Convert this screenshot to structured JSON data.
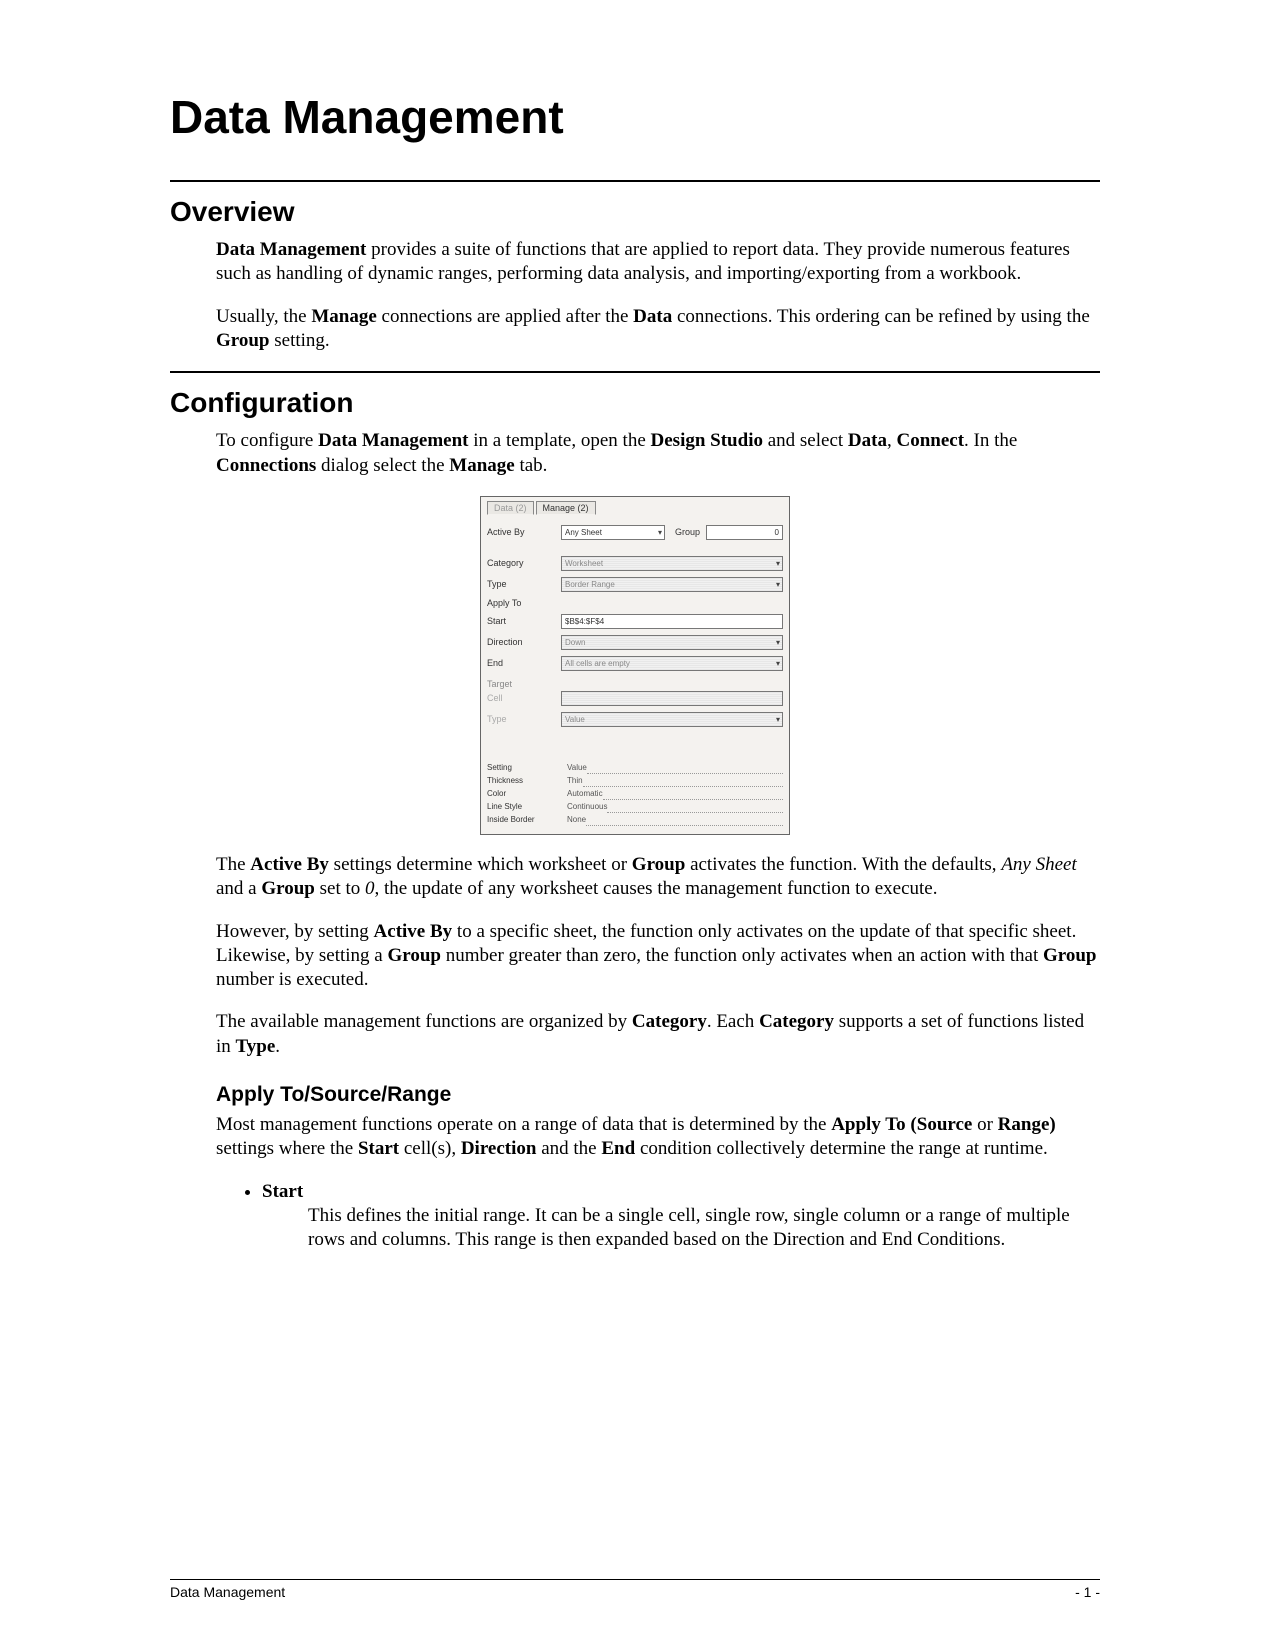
{
  "title": "Data Management",
  "sections": {
    "overview": {
      "heading": "Overview",
      "p1_pre": "Data Management",
      "p1_post": " provides a suite of functions that are applied to report data.  They provide numerous features such as handling of dynamic ranges, performing data analysis, and importing/exporting from a workbook.",
      "p2_a": "Usually, the ",
      "p2_b": "Manage",
      "p2_c": " connections are applied after the ",
      "p2_d": "Data",
      "p2_e": " connections.  This ordering can be refined by using the ",
      "p2_f": "Group",
      "p2_g": " setting."
    },
    "config": {
      "heading": "Configuration",
      "p1_a": "To configure ",
      "p1_b": "Data Management",
      "p1_c": " in a template, open the ",
      "p1_d": "Design Studio",
      "p1_e": " and select ",
      "p1_f": "Data",
      "p1_g": ", ",
      "p1_h": "Connect",
      "p1_i": ".  In the ",
      "p1_j": "Connections",
      "p1_k": " dialog select the ",
      "p1_l": "Manage",
      "p1_m": " tab.",
      "p2_a": "The ",
      "p2_b": "Active By",
      "p2_c": " settings determine which worksheet or ",
      "p2_d": "Group",
      "p2_e": " activates the function.  With the defaults, ",
      "p2_f": "Any Sheet",
      "p2_g": " and a ",
      "p2_h": "Group",
      "p2_i": " set to ",
      "p2_j": "0",
      "p2_k": ", the update of any worksheet causes the management function to execute.",
      "p3_a": "However, by setting ",
      "p3_b": "Active By",
      "p3_c": " to a specific sheet, the function only activates on the update of that specific sheet.  Likewise, by setting a ",
      "p3_d": "Group",
      "p3_e": " number greater than zero, the function only activates when an action with that ",
      "p3_f": "Group",
      "p3_g": " number is executed.",
      "p4_a": "The available management functions are organized by ",
      "p4_b": "Category",
      "p4_c": ".  Each ",
      "p4_d": "Category",
      "p4_e": " supports a set of functions listed in ",
      "p4_f": "Type",
      "p4_g": "."
    },
    "apply": {
      "heading": "Apply To/Source/Range",
      "p1_a": "Most management functions operate on a range of data that is determined by the ",
      "p1_b": "Apply To (Source",
      "p1_c": " or ",
      "p1_d": "Range)",
      "p1_e": " settings where the ",
      "p1_f": "Start",
      "p1_g": " cell(s), ",
      "p1_h": "Direction",
      "p1_i": " and the ",
      "p1_j": "End",
      "p1_k": " condition collectively determine the range at runtime.",
      "bullet_head": "Start",
      "bullet_text": "This defines the initial range.  It can be a single cell, single row, single column or a range of multiple rows and columns.  This range is then expanded based on the Direction and End Conditions."
    }
  },
  "dialog": {
    "tabs": {
      "data": "Data (2)",
      "manage": "Manage (2)"
    },
    "activeByLabel": "Active By",
    "activeByValue": "Any Sheet",
    "groupLabel": "Group",
    "groupValue": "0",
    "categoryLabel": "Category",
    "categoryValue": "Worksheet",
    "typeLabel": "Type",
    "typeValue": "Border Range",
    "applyToLabel": "Apply To",
    "startLabel": "Start",
    "startValue": "$B$4:$F$4",
    "directionLabel": "Direction",
    "directionValue": "Down",
    "endLabel": "End",
    "endValue": "All cells are empty",
    "targetLabel": "Target",
    "cellLabel": "Cell",
    "cellValue": "",
    "type2Label": "Type",
    "type2Value": "Value",
    "settings": {
      "settingLbl": "Setting",
      "valueLbl": "Value",
      "thicknessLbl": "Thickness",
      "thicknessVal": "Thin",
      "colorLbl": "Color",
      "colorVal": "Automatic",
      "lineStyleLbl": "Line Style",
      "lineStyleVal": "Continuous",
      "insideBorderLbl": "Inside Border",
      "insideBorderVal": "None"
    }
  },
  "footer": {
    "left": "Data Management",
    "right": "- 1 -"
  }
}
